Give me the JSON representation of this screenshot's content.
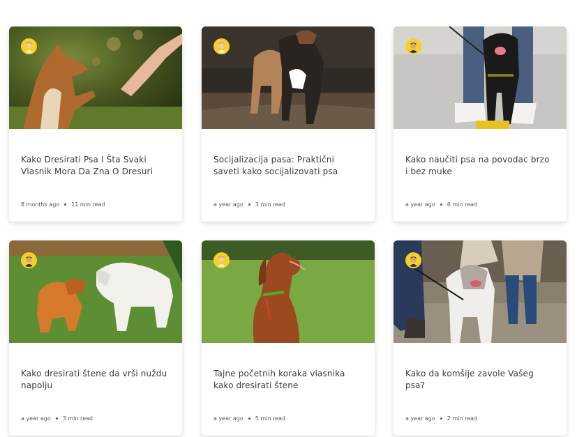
{
  "cards": [
    {
      "title": "Kako Dresirati Psa I Šta Svaki Vlasnik Mora Da Zna O Dresuri",
      "age": "8 months ago",
      "read": "11 min read",
      "avatar": "woman-avatar"
    },
    {
      "title": "Socijalizacija pasa: Praktični saveti kako socijalizovati psa",
      "age": "a year ago",
      "read": "3 min read",
      "avatar": "woman-avatar"
    },
    {
      "title": "Kako naučiti psa na povodac brzo i bez muke",
      "age": "a year ago",
      "read": "6 min read",
      "avatar": "man-avatar"
    },
    {
      "title": "Kako dresirati štene da vrši nuždu napolju",
      "age": "a year ago",
      "read": "3 min read",
      "avatar": "man-avatar"
    },
    {
      "title": "Tajne početnih koraka vlasnika kako dresirati štene",
      "age": "a year ago",
      "read": "5 min read",
      "avatar": "woman-avatar"
    },
    {
      "title": "Kako da komšije zavole Vašeg psa?",
      "age": "a year ago",
      "read": "2 min read",
      "avatar": "man-avatar"
    }
  ],
  "colors": {
    "avatar_ring": "#f5cf2a",
    "title": "#3a3a3a",
    "meta": "#555555"
  }
}
